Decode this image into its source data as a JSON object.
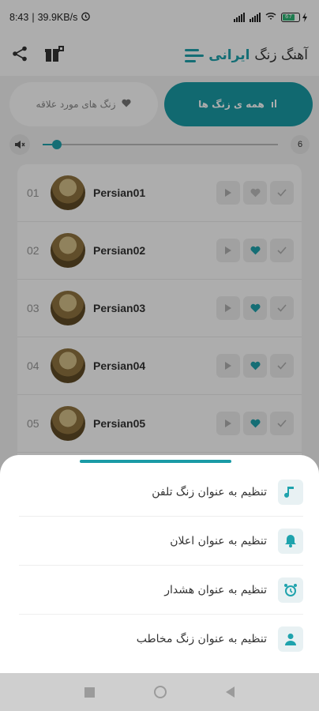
{
  "status_bar": {
    "time": "8:43",
    "net_speed": "39.9KB/s",
    "battery": "67"
  },
  "header": {
    "title_part1": "آهنگ زنگ",
    "title_part2": "ایرانی",
    "icons": [
      "menu-icon",
      "gift-icon",
      "share-icon"
    ]
  },
  "tabs": {
    "all": "همه ی زنگ ها",
    "favorites": "زنگ های مورد علاقه"
  },
  "volume": {
    "level": 6,
    "fraction": 0.06
  },
  "list": {
    "items": [
      {
        "num": "01",
        "name": "Persian01",
        "favorited": false
      },
      {
        "num": "02",
        "name": "Persian02",
        "favorited": true
      },
      {
        "num": "03",
        "name": "Persian03",
        "favorited": true
      },
      {
        "num": "04",
        "name": "Persian04",
        "favorited": true
      },
      {
        "num": "05",
        "name": "Persian05",
        "favorited": true
      }
    ]
  },
  "sheet": {
    "options": [
      {
        "label": "تنظیم به عنوان زنگ تلفن",
        "icon": "music-note-icon"
      },
      {
        "label": "تنظیم به عنوان اعلان",
        "icon": "bell-icon"
      },
      {
        "label": "تنظیم به عنوان هشدار",
        "icon": "alarm-clock-icon"
      },
      {
        "label": "تنظیم به عنوان زنگ مخاطب",
        "icon": "person-icon"
      }
    ]
  },
  "colors": {
    "accent": "#1fa3ad",
    "tab_active": "#1a9ba6"
  }
}
